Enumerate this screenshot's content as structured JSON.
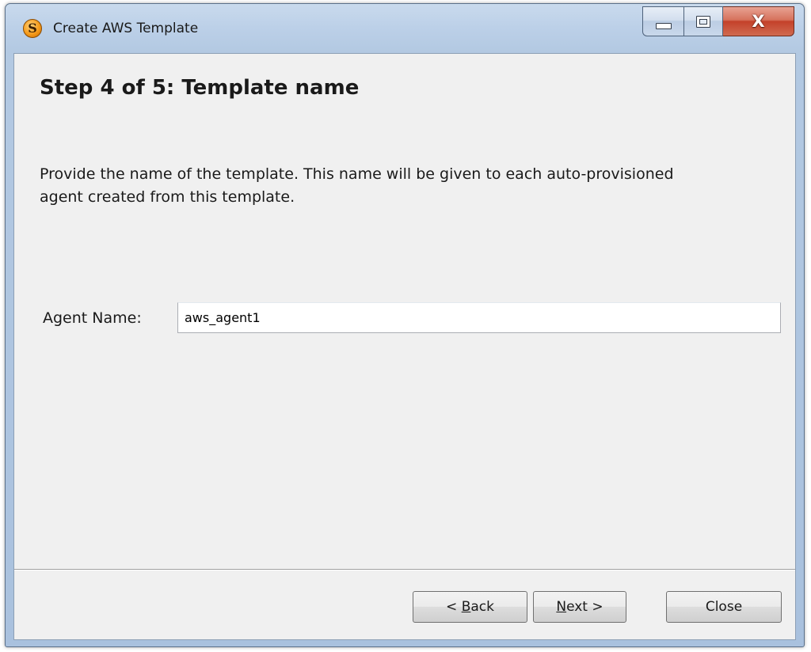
{
  "window": {
    "title": "Create AWS Template",
    "app_icon_glyph": "S",
    "app_icon": "s-logo-icon",
    "controls": {
      "minimize_icon": "minimize-icon",
      "maximize_icon": "maximize-icon",
      "close_icon": "close-icon",
      "close_glyph": "X"
    },
    "close_color": "#c4412a"
  },
  "wizard": {
    "step_title": "Step 4 of 5: Template name",
    "description": "Provide the name of the template. This name will be given to each auto-provisioned agent created from this template."
  },
  "form": {
    "agent_name_label": "Agent Name:",
    "agent_name_value": "aws_agent1"
  },
  "buttons": {
    "back": {
      "prefix": "< ",
      "mnemonic": "B",
      "rest": "ack"
    },
    "next": {
      "prefix": "",
      "mnemonic": "N",
      "rest": "ext >"
    },
    "close_label": "Close"
  }
}
